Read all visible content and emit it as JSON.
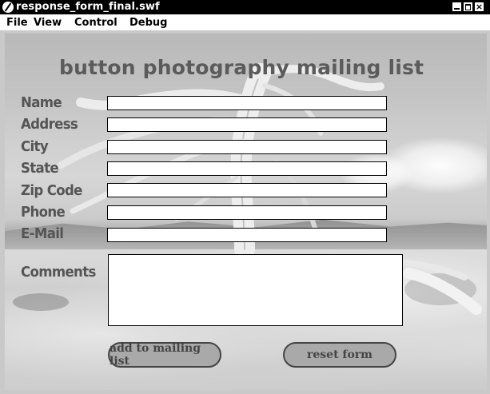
{
  "window": {
    "title": "response_form_final.swf",
    "close_glyph": "×"
  },
  "menu": {
    "file": "File",
    "view": "View",
    "control": "Control",
    "debug": "Debug"
  },
  "form": {
    "heading": "button photography mailing list",
    "fields": {
      "name": {
        "label": "Name",
        "value": ""
      },
      "address": {
        "label": "Address",
        "value": ""
      },
      "city": {
        "label": "City",
        "value": ""
      },
      "state": {
        "label": "State",
        "value": ""
      },
      "zip": {
        "label": "Zip Code",
        "value": ""
      },
      "phone": {
        "label": "Phone",
        "value": ""
      },
      "email": {
        "label": "E-Mail",
        "value": ""
      }
    },
    "comments": {
      "label": "Comments",
      "value": ""
    },
    "buttons": {
      "add": "add to mailing list",
      "reset": "reset form"
    }
  },
  "icons": {
    "app": "flash-player-icon",
    "minimize": "minimize-icon",
    "maximize": "maximize-icon",
    "close": "close-icon"
  }
}
